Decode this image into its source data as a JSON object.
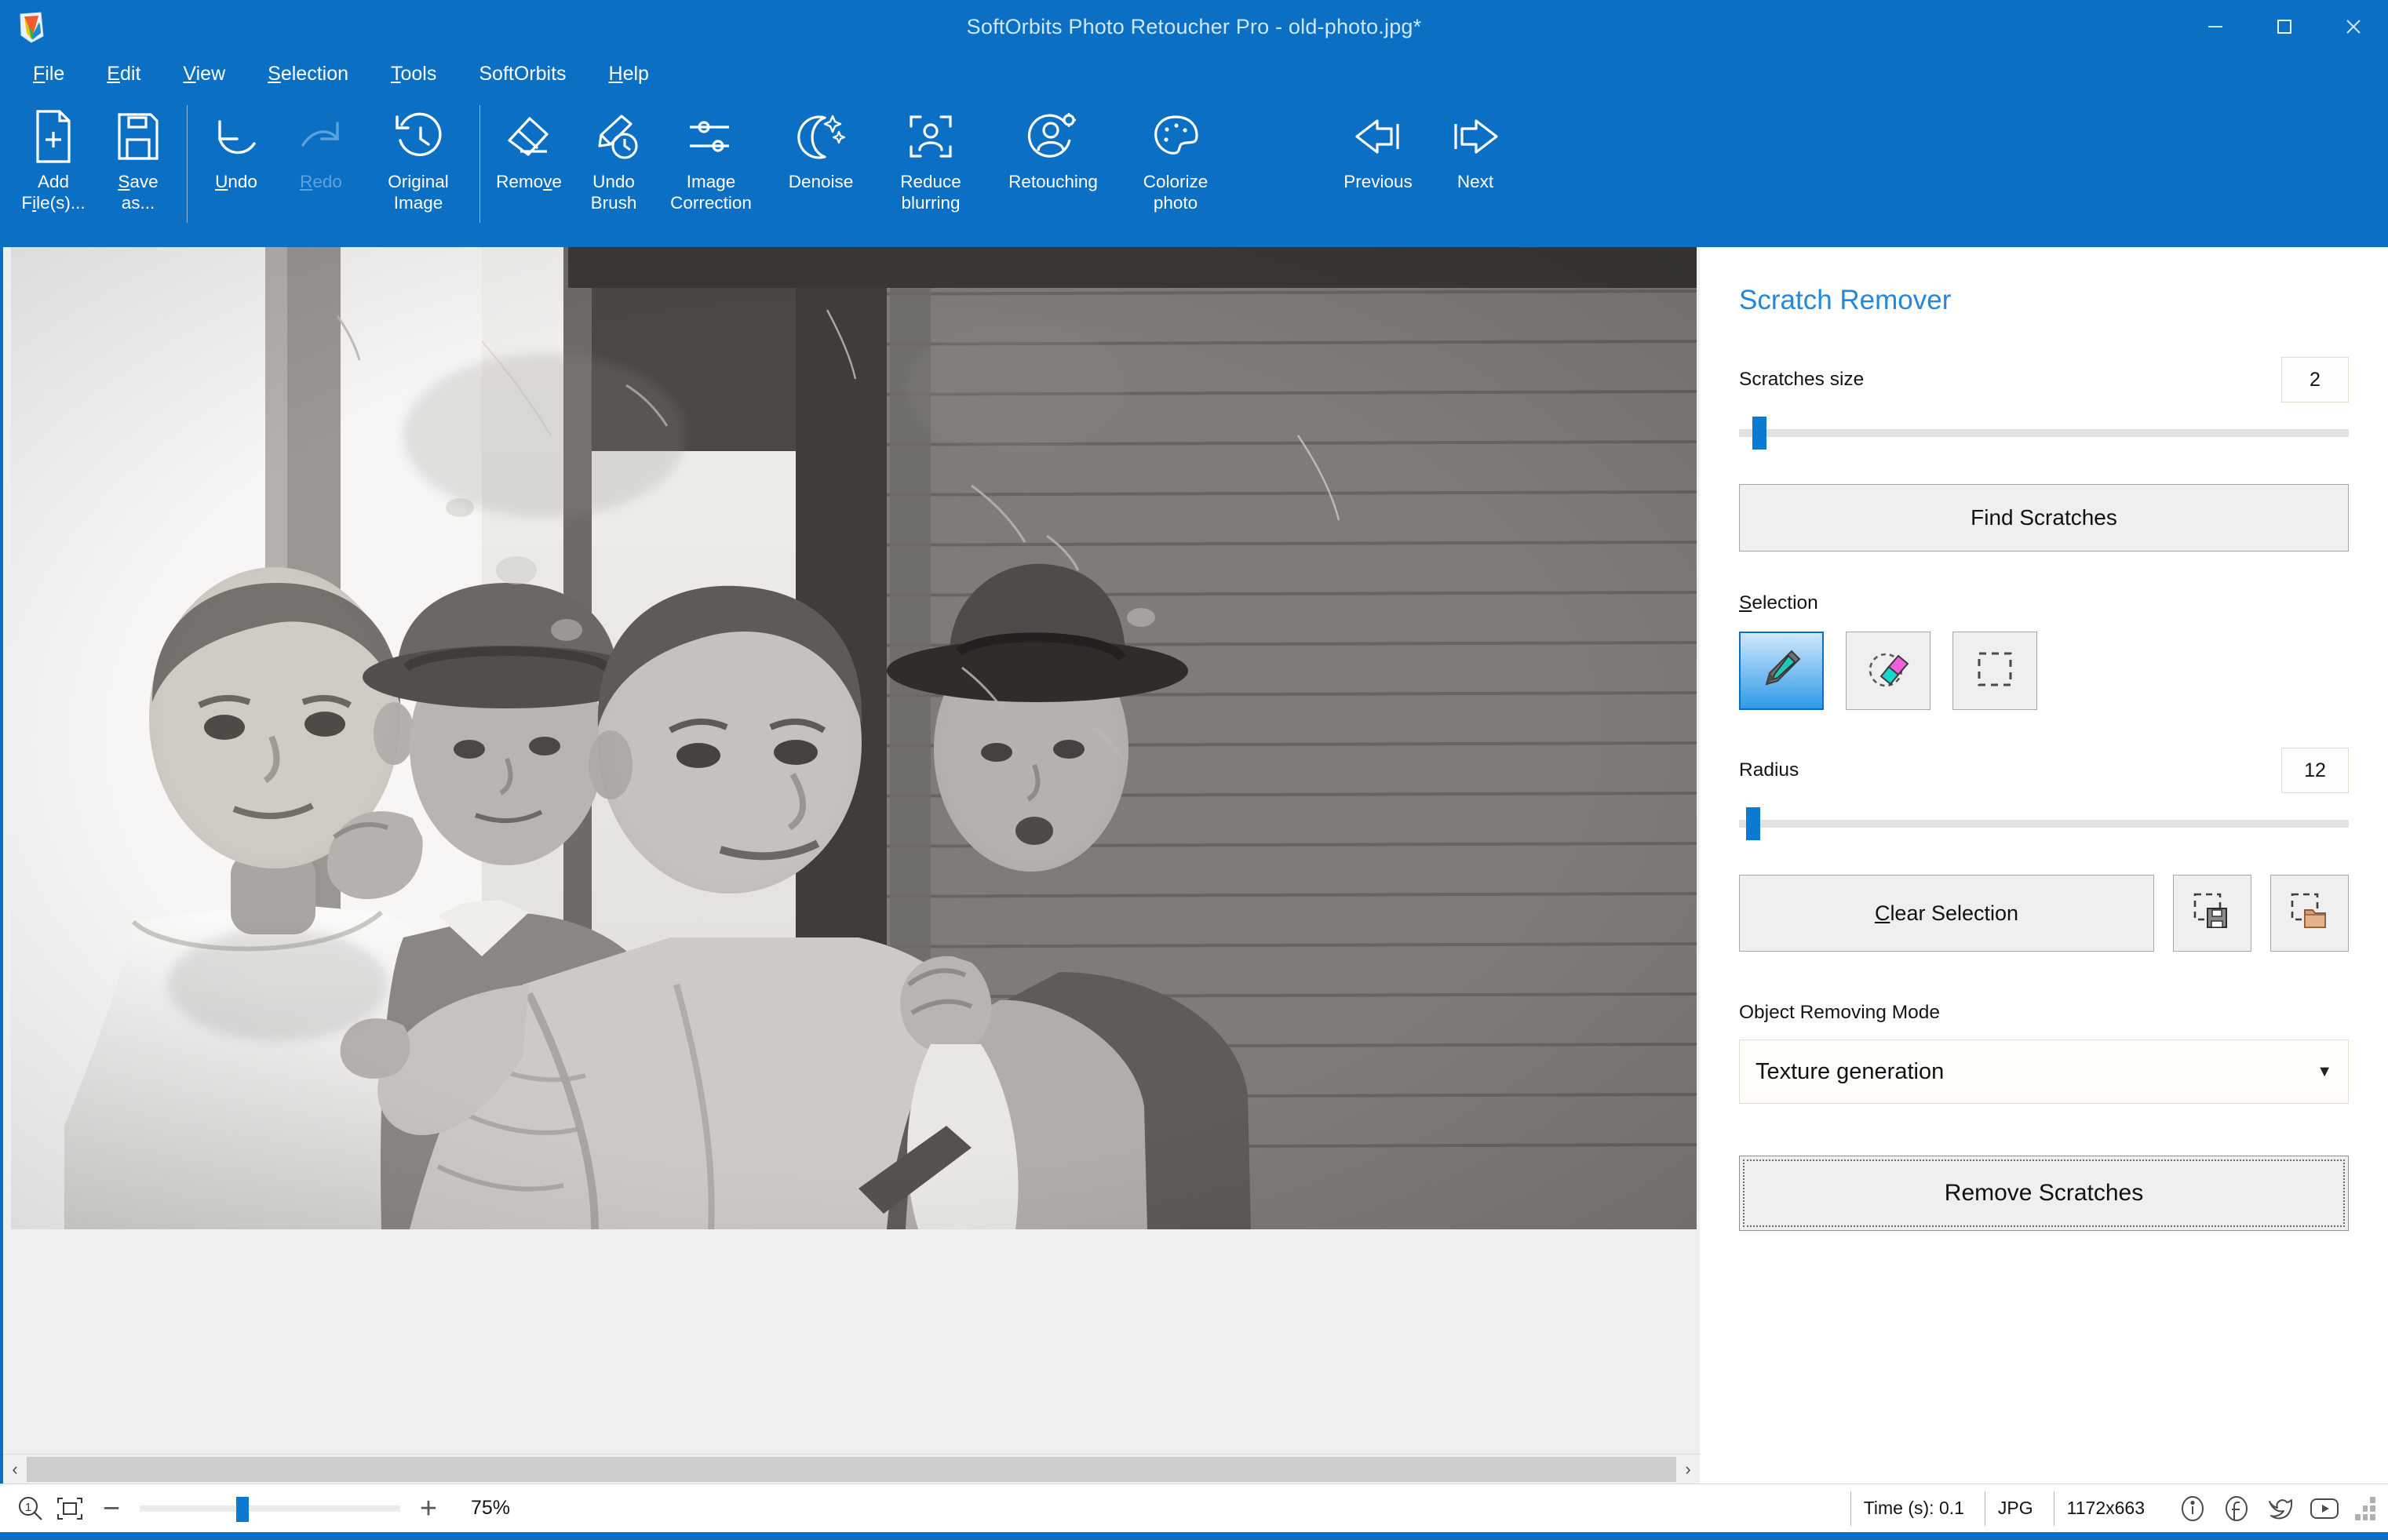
{
  "window": {
    "title": "SoftOrbits Photo Retoucher Pro - old-photo.jpg*",
    "logo_icon": "app-logo-icon",
    "minimize_icon": "minimize-icon",
    "maximize_icon": "maximize-icon",
    "close_icon": "close-icon",
    "accent_color": "#0b6fc4",
    "panel_title_color": "#2288dd"
  },
  "menu": {
    "items": [
      {
        "label": "File",
        "accel": "F"
      },
      {
        "label": "Edit",
        "accel": "E"
      },
      {
        "label": "View",
        "accel": "V"
      },
      {
        "label": "Selection",
        "accel": "S"
      },
      {
        "label": "Tools",
        "accel": "T"
      },
      {
        "label": "SoftOrbits",
        "accel": ""
      },
      {
        "label": "Help",
        "accel": "H"
      }
    ]
  },
  "toolbar": {
    "buttons": [
      {
        "label_line1": "Add",
        "label_line2": "File(s)...",
        "icon": "file-plus-icon",
        "disabled": false
      },
      {
        "label_line1": "Save",
        "label_line2": "as...",
        "icon": "floppy-save-icon",
        "disabled": false
      },
      {
        "label_line1": "Undo",
        "label_line2": "",
        "icon": "undo-arrow-icon",
        "disabled": false
      },
      {
        "label_line1": "Redo",
        "label_line2": "",
        "icon": "redo-arrow-icon",
        "disabled": true
      },
      {
        "label_line1": "Original",
        "label_line2": "Image",
        "icon": "history-clock-icon",
        "disabled": false
      },
      {
        "label_line1": "Remove",
        "label_line2": "",
        "icon": "eraser-icon",
        "disabled": false
      },
      {
        "label_line1": "Undo",
        "label_line2": "Brush",
        "icon": "brush-clock-icon",
        "disabled": false
      },
      {
        "label_line1": "Image",
        "label_line2": "Correction",
        "icon": "sliders-icon",
        "disabled": false
      },
      {
        "label_line1": "Denoise",
        "label_line2": "",
        "icon": "moon-sparkle-icon",
        "disabled": false
      },
      {
        "label_line1": "Reduce",
        "label_line2": "blurring",
        "icon": "portrait-focus-icon",
        "disabled": false
      },
      {
        "label_line1": "Retouching",
        "label_line2": "",
        "icon": "person-gear-icon",
        "disabled": false
      },
      {
        "label_line1": "Colorize",
        "label_line2": "photo",
        "icon": "palette-icon",
        "disabled": false
      },
      {
        "label_line1": "Previous",
        "label_line2": "",
        "icon": "arrow-left-bar-icon",
        "disabled": false
      },
      {
        "label_line1": "Next",
        "label_line2": "",
        "icon": "arrow-right-bar-icon",
        "disabled": false
      }
    ]
  },
  "panel": {
    "title": "Scratch Remover",
    "scratches_size": {
      "label": "Scratches size",
      "value": "2",
      "slider_percent": 6
    },
    "find_scratches_button": "Find Scratches",
    "selection": {
      "label": "Selection",
      "accel": "S",
      "tools": [
        {
          "name": "marker-tool",
          "icon": "marker-pen-icon",
          "active": true
        },
        {
          "name": "eraser-tool",
          "icon": "eraser-selection-icon",
          "active": false
        },
        {
          "name": "rectangle-tool",
          "icon": "marquee-rect-icon",
          "active": false
        }
      ]
    },
    "radius": {
      "label": "Radius",
      "value": "12",
      "slider_percent": 4
    },
    "clear_selection_button": "Clear Selection",
    "save_selection_icon": "save-selection-icon",
    "load_selection_icon": "load-selection-icon",
    "object_removing_mode": {
      "label": "Object Removing Mode",
      "selected": "Texture generation",
      "caret_icon": "chevron-down-icon"
    },
    "remove_scratches_button": "Remove Scratches"
  },
  "canvas": {
    "scroll_left_icon": "chevron-left-icon",
    "scroll_right_icon": "chevron-right-icon",
    "photo_alt": "old-photo-barbershop-scene"
  },
  "statusbar": {
    "zoom_100_icon": "zoom-actual-size-icon",
    "fit_window_icon": "fit-to-window-icon",
    "zoom_out_icon": "minus-icon",
    "zoom_in_icon": "plus-icon",
    "zoom_percent": "75%",
    "zoom_slider_percent": 38,
    "time": "Time (s): 0.1",
    "format": "JPG",
    "dimensions": "1172x663",
    "social": [
      {
        "name": "info-icon",
        "label": "i"
      },
      {
        "name": "facebook-icon",
        "label": "f"
      },
      {
        "name": "twitter-icon",
        "label": "t"
      },
      {
        "name": "youtube-icon",
        "label": "y"
      }
    ]
  }
}
